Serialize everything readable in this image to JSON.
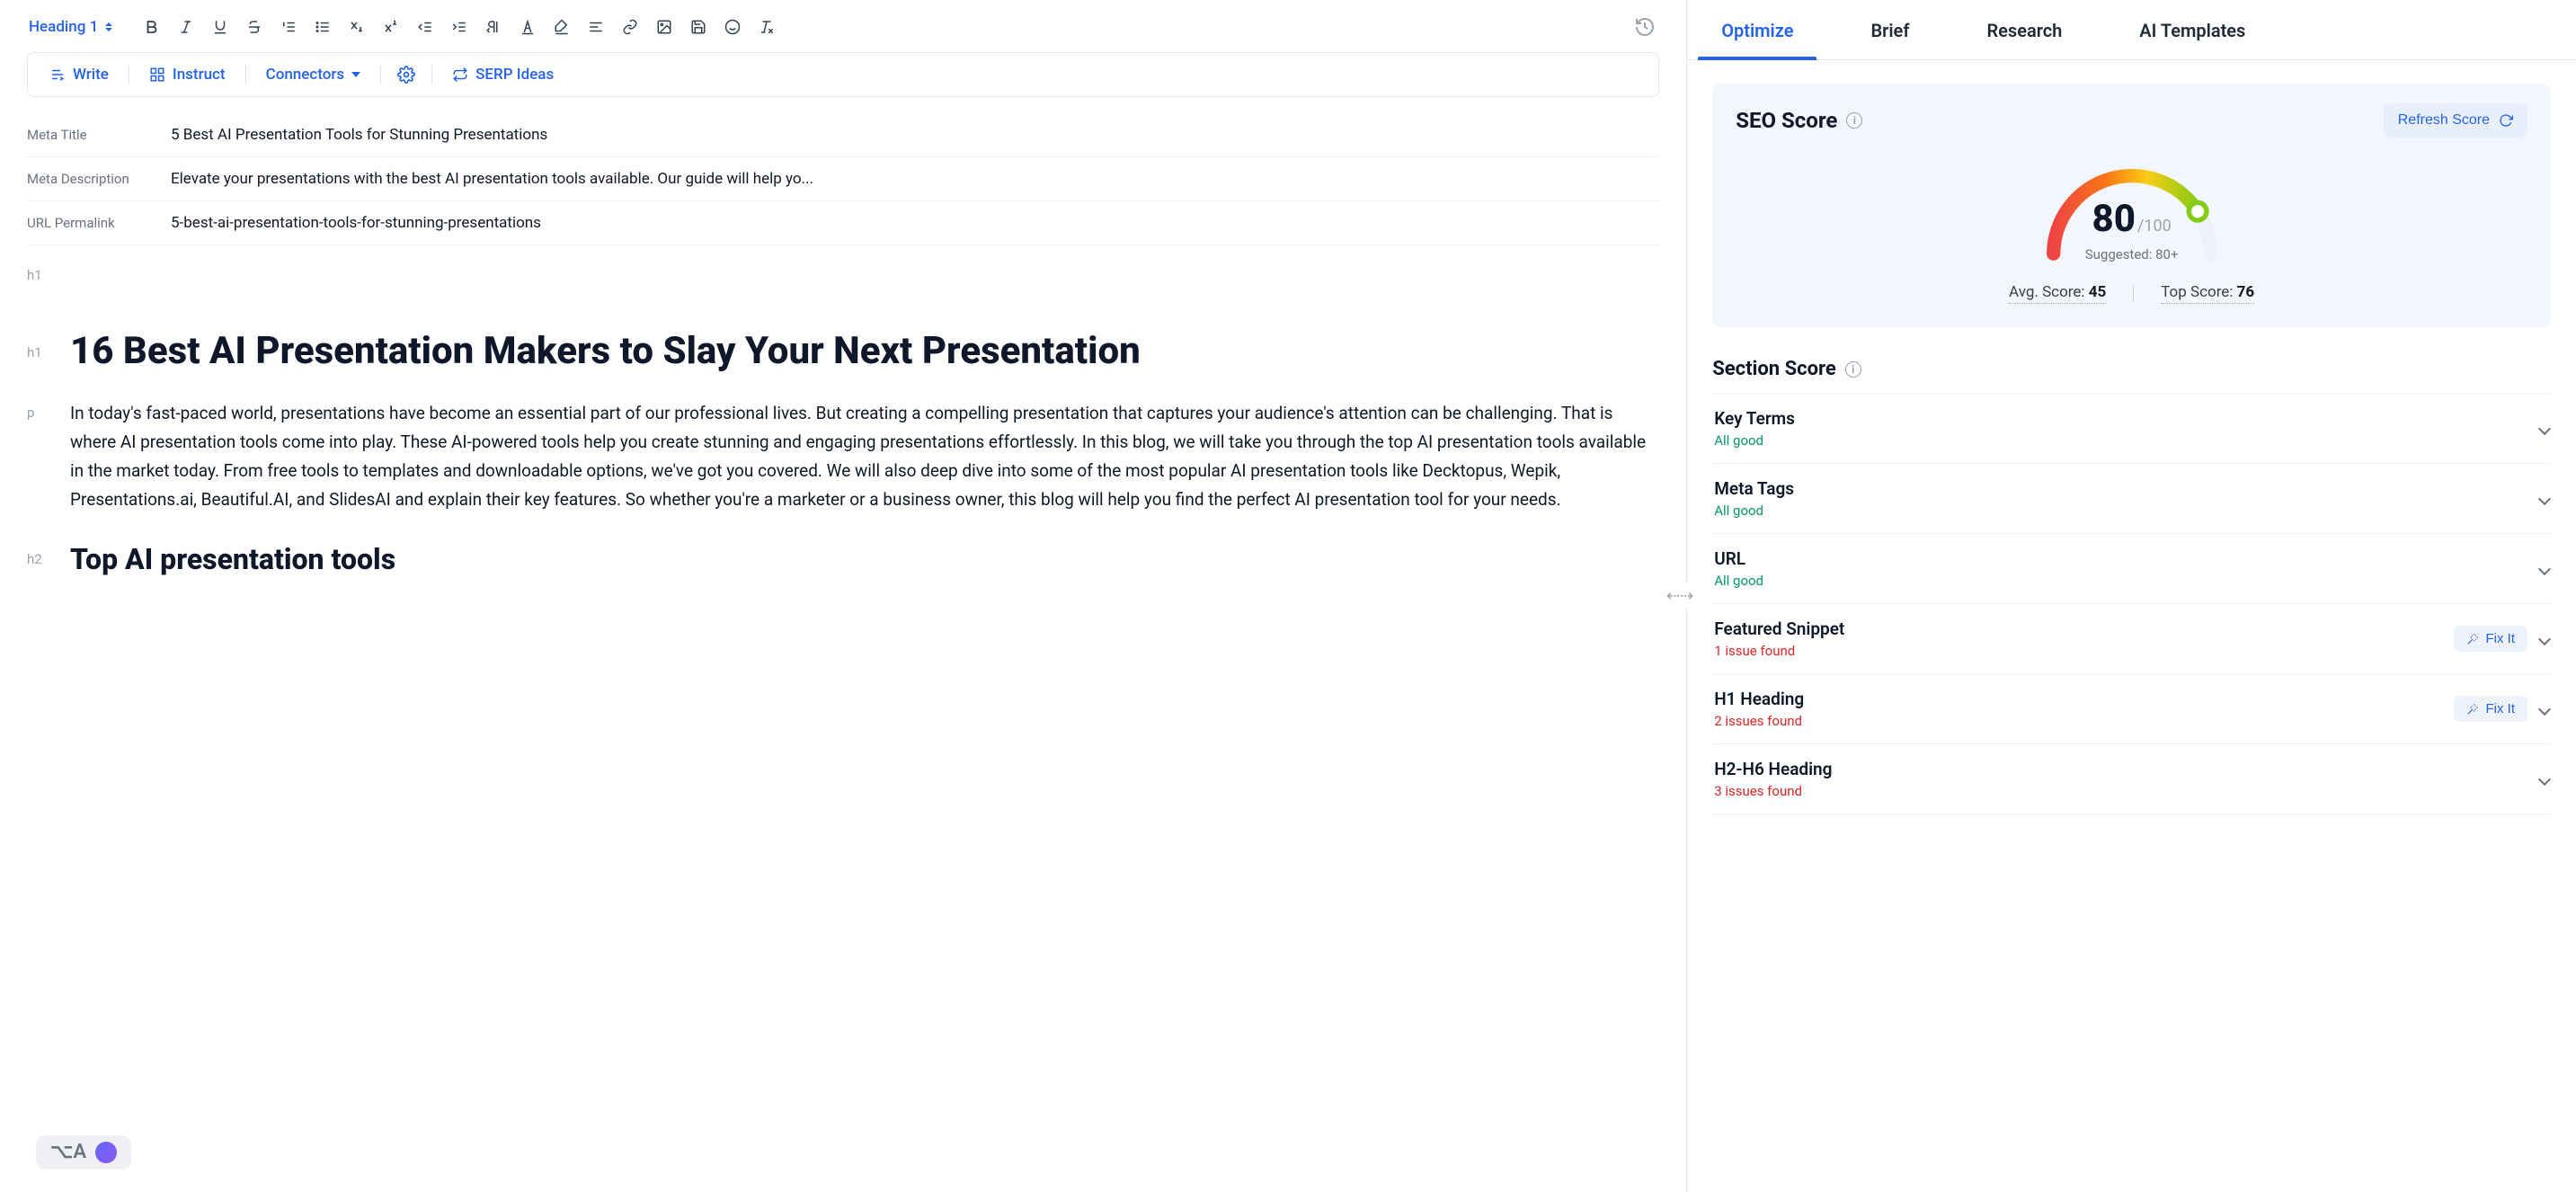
{
  "toolbar": {
    "heading_label": "Heading 1"
  },
  "secondary": {
    "write": "Write",
    "instruct": "Instruct",
    "connectors": "Connectors",
    "serp": "SERP Ideas"
  },
  "meta": {
    "title_label": "Meta Title",
    "title_value": "5 Best AI Presentation Tools for Stunning Presentations",
    "desc_label": "Meta Description",
    "desc_value": "Elevate your presentations with the best AI presentation tools available. Our guide will help yo...",
    "url_label": "URL Permalink",
    "url_value": "5-best-ai-presentation-tools-for-stunning-presentations"
  },
  "doc": {
    "gutter_h1": "h1",
    "gutter_p": "p",
    "gutter_h2": "h2",
    "h1": "16 Best AI Presentation Makers to Slay Your Next Presentation",
    "p1": "In today's fast-paced world, presentations have become an essential part of our professional lives. But creating a compelling presentation that captures your audience's attention can be challenging. That is where AI presentation tools come into play. These AI-powered tools help you create stunning and engaging presentations effortlessly. In this blog, we will take you through the top AI presentation tools available in the market today. From free tools to templates and downloadable options, we've got you covered. We will also deep dive into some of the most popular AI presentation tools like Decktopus, Wepik, Presentations.ai, Beautiful.AI, and SlidesAI and explain their key features. So whether you're a marketer or a business owner, this blog will help you find the perfect AI presentation tool for your needs.",
    "h2": "Top AI presentation tools"
  },
  "float_badge": "⌥A",
  "tabs": {
    "optimize": "Optimize",
    "brief": "Brief",
    "research": "Research",
    "templates": "AI Templates"
  },
  "seo": {
    "title": "SEO Score",
    "refresh": "Refresh Score",
    "score": "80",
    "max": "/100",
    "suggested": "Suggested: 80+",
    "avg_label": "Avg. Score: ",
    "avg_value": "45",
    "top_label": "Top Score: ",
    "top_value": "76"
  },
  "section_score": {
    "title": "Section Score",
    "fixit": "Fix It",
    "items": [
      {
        "name": "Key Terms",
        "status": "All good",
        "kind": "good",
        "fixit": false
      },
      {
        "name": "Meta Tags",
        "status": "All good",
        "kind": "good",
        "fixit": false
      },
      {
        "name": "URL",
        "status": "All good",
        "kind": "good",
        "fixit": false
      },
      {
        "name": "Featured Snippet",
        "status": "1 issue found",
        "kind": "warn",
        "fixit": true
      },
      {
        "name": "H1 Heading",
        "status": "2 issues found",
        "kind": "warn",
        "fixit": true
      },
      {
        "name": "H2-H6 Heading",
        "status": "3 issues found",
        "kind": "warn",
        "fixit": false
      }
    ]
  },
  "colors": {
    "primary": "#2563eb",
    "good": "#059669",
    "warn": "#dc2626"
  }
}
